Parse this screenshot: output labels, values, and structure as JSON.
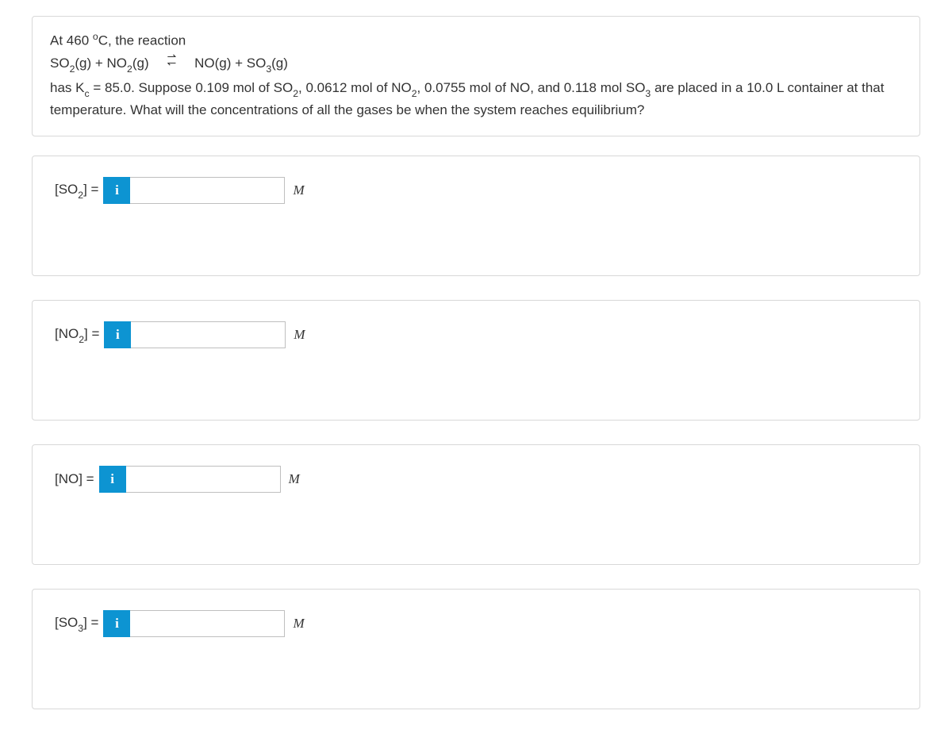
{
  "question": {
    "line1_pre": "At 460 ",
    "line1_post": "C, the reaction",
    "eq_left_a": "SO",
    "eq_left_b": "(g) + NO",
    "eq_left_c": "(g)",
    "eq_right_a": "NO(g) + SO",
    "eq_right_b": "(g)",
    "line3_a": "has K",
    "line3_b": " = 85.0. Suppose 0.109 mol of SO",
    "line3_c": ", 0.0612 mol of NO",
    "line3_d": ", 0.0755 mol of NO, and 0.118 mol SO",
    "line3_e": " are placed in a 10.0 L container at that temperature. What will the concentrations of all the gases be when the system reaches equilibrium?"
  },
  "answers": [
    {
      "label_a": "[SO",
      "label_sub": "2",
      "label_b": "] =",
      "unit": "M",
      "value": ""
    },
    {
      "label_a": "[NO",
      "label_sub": "2",
      "label_b": "] =",
      "unit": "M",
      "value": ""
    },
    {
      "label_a": "[NO] =",
      "label_sub": "",
      "label_b": "",
      "unit": "M",
      "value": ""
    },
    {
      "label_a": "[SO",
      "label_sub": "3",
      "label_b": "] =",
      "unit": "M",
      "value": ""
    }
  ],
  "info_icon_text": "i"
}
